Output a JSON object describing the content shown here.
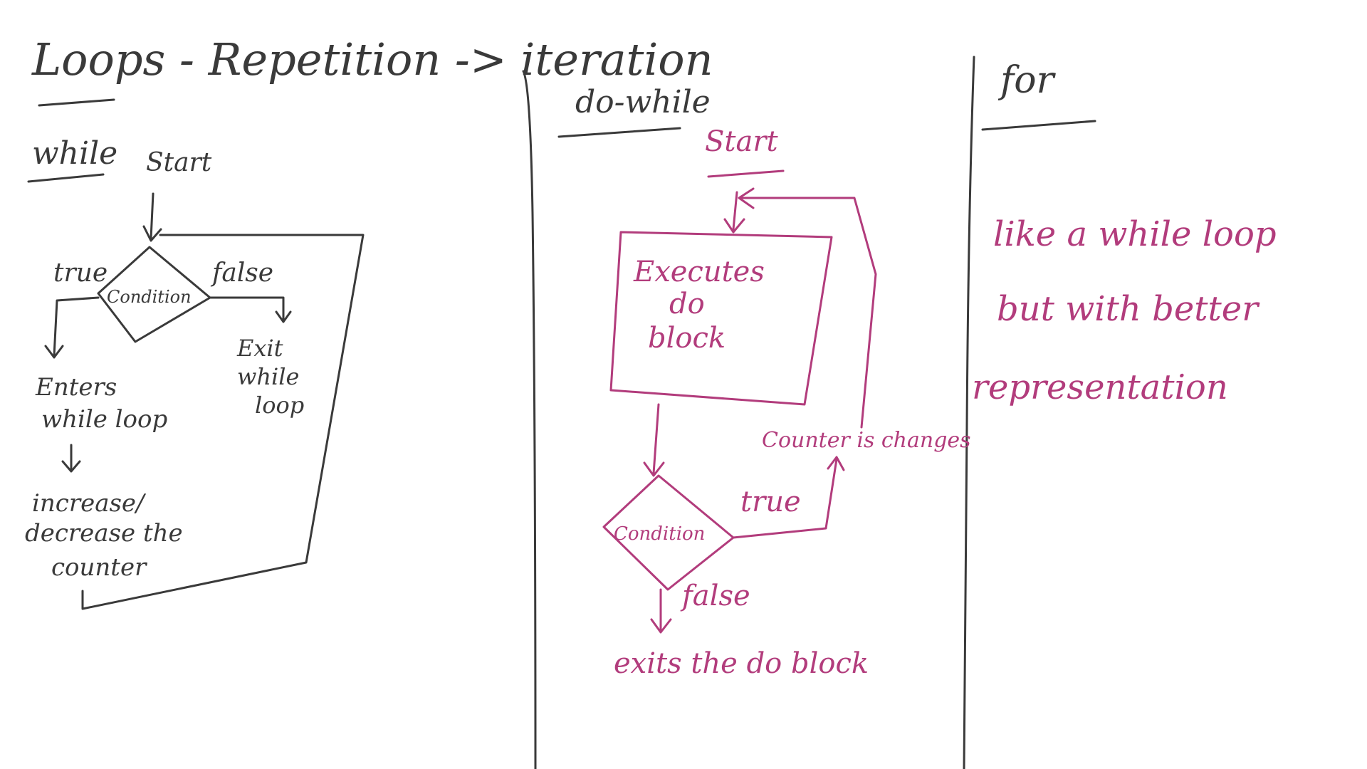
{
  "title": "Loops - Repetition -> iteration",
  "columns": {
    "while": {
      "heading": "while",
      "start": "Start",
      "condition": "Condition",
      "true_label": "true",
      "false_label": "false",
      "enters": [
        "Enters",
        "while loop"
      ],
      "exit": [
        "Exit",
        "while",
        "loop"
      ],
      "step": [
        "increase/",
        "decrease the",
        "counter"
      ]
    },
    "do_while": {
      "heading": "do-while",
      "start": "Start",
      "block": [
        "Executes",
        "do",
        "block"
      ],
      "condition": "Condition",
      "true_label": "true",
      "false_label": "false",
      "counter_note": "Counter is changes",
      "exit": "exits the do block"
    },
    "for": {
      "heading": "for",
      "notes": [
        "like a while loop",
        "but with better",
        "representation"
      ]
    }
  },
  "colors": {
    "dark_ink": "#3a3a3a",
    "pink_ink": "#b23c7c",
    "background": "#ffffff"
  }
}
